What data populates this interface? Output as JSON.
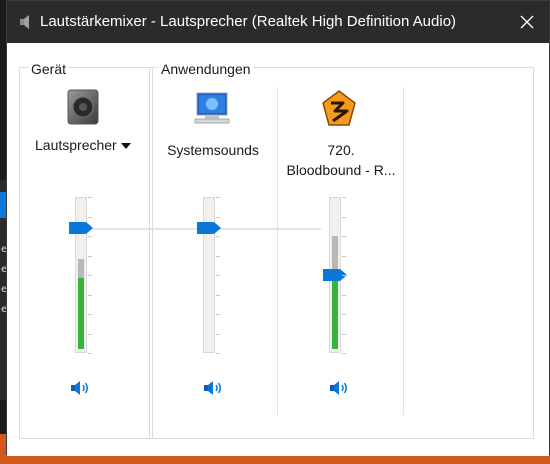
{
  "window": {
    "title": "Lautstärkemixer - Lautsprecher (Realtek High Definition Audio)"
  },
  "device_group": {
    "label": "Gerät",
    "device_name": "Lautsprecher",
    "level": 0.8,
    "peak": 0.6,
    "meter": 0.48
  },
  "apps_group": {
    "label": "Anwendungen",
    "apps": [
      {
        "name_line1": "Systemsounds",
        "name_line2": "",
        "level": 0.8,
        "meter": 0
      },
      {
        "name_line1": "720.",
        "name_line2": "Bloodbound - R...",
        "level": 0.5,
        "peak": 0.75,
        "meter": 0.5
      }
    ]
  },
  "background": {
    "left_strip_letters": [
      "e",
      "e",
      "e",
      "e"
    ]
  },
  "colors": {
    "titlebar": "#2b2b2b",
    "thumb": "#0a78d7",
    "meter_green": "#35b33a",
    "meter_gray": "#b7b7b7",
    "taskbar_orange": "#d15a1a"
  },
  "icons": {
    "title": "speaker-icon",
    "device": "speaker-device-icon",
    "system": "system-sounds-icon",
    "app2": "vlc-winamp-icon",
    "mute": "volume-speaker-icon"
  }
}
